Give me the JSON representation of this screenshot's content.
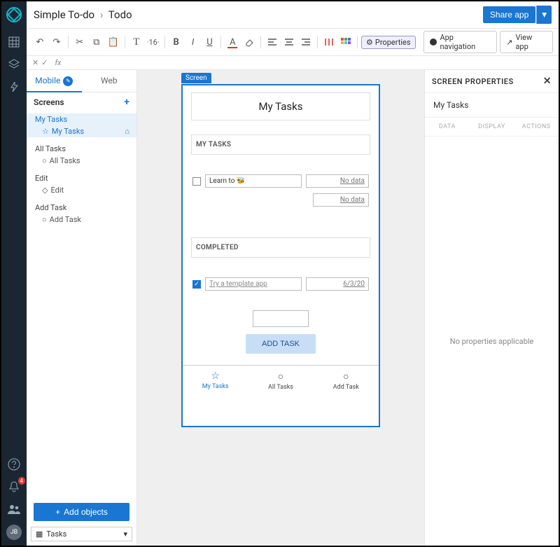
{
  "breadcrumb": {
    "app": "Simple To-do",
    "page": "Todo"
  },
  "header": {
    "share": "Share app"
  },
  "toolbar": {
    "font_glyph": "T",
    "font_size": "16",
    "bold": "B",
    "italic": "I",
    "underline": "U",
    "textcolor": "A",
    "properties": "Properties",
    "app_nav": "App navigation",
    "view_app": "View app"
  },
  "fx": {
    "label": "fx"
  },
  "side": {
    "tab_mobile": "Mobile",
    "tab_web": "Web",
    "mobile_tab_badge": "✎",
    "section": "Screens",
    "nodes": {
      "mytasks": "My Tasks",
      "mytasks_child": "My Tasks",
      "alltasks": "All Tasks",
      "alltasks_child": "All Tasks",
      "edit": "Edit",
      "edit_child": "Edit",
      "addtask": "Add Task",
      "addtask_child": "Add Task"
    },
    "add_objects": "Add objects",
    "table_selector": "Tasks"
  },
  "canvas": {
    "badge": "Screen",
    "title": "My Tasks",
    "section1": "MY TASKS",
    "task1_text": "Learn to 🐝",
    "task1_meta": "No data",
    "task1_meta2": "No data",
    "section2": "COMPLETED",
    "task2_text": "Try a template app",
    "task2_meta": "6/3/20",
    "add_task_btn": "ADD TASK",
    "nav": {
      "mytasks": "My Tasks",
      "alltasks": "All Tasks",
      "addtask": "Add Task"
    }
  },
  "rpanel": {
    "title": "SCREEN PROPERTIES",
    "subtitle": "My Tasks",
    "tab_data": "DATA",
    "tab_display": "DISPLAY",
    "tab_actions": "ACTIONS",
    "empty": "No properties applicable"
  },
  "rail": {
    "avatar": "JB",
    "notif_badge": "4"
  }
}
